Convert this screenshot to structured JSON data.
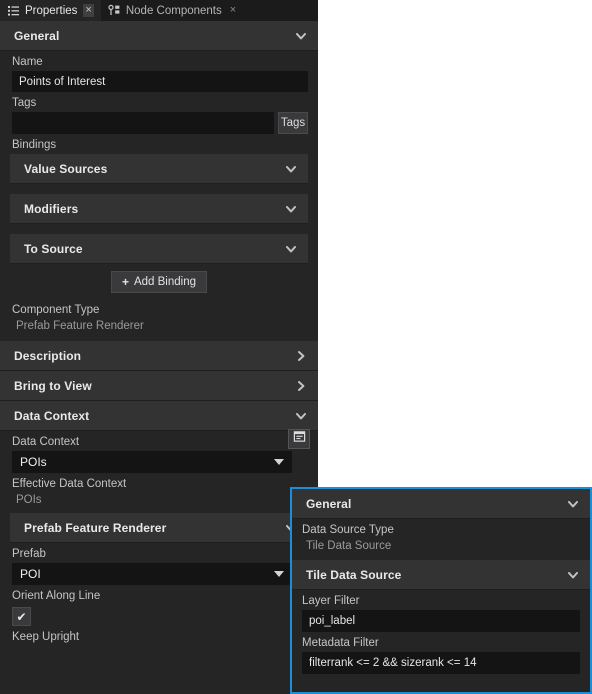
{
  "tabs": [
    {
      "label": "Properties",
      "icon": "list-icon",
      "close": "×",
      "active": true
    },
    {
      "label": "Node Components",
      "icon": "node-components-icon",
      "close": "×",
      "active": false
    }
  ],
  "properties": {
    "general_section": "General",
    "name_label": "Name",
    "name_value": "Points of Interest",
    "tags_label": "Tags",
    "tags_value": "",
    "tags_button": "Tags",
    "bindings_label": "Bindings",
    "binding_sections": [
      {
        "title": "Value Sources",
        "state": "collapsed-down"
      },
      {
        "title": "Modifiers",
        "state": "collapsed-down"
      },
      {
        "title": "To Source",
        "state": "collapsed-down"
      }
    ],
    "add_binding_label": "Add Binding",
    "add_binding_plus": "+",
    "component_type_label": "Component Type",
    "component_type_value": "Prefab Feature Renderer",
    "description_section": "Description",
    "bring_to_view_section": "Bring to View",
    "data_context_section": "Data Context",
    "data_context_label": "Data Context",
    "data_context_value": "POIs",
    "data_context_button_icon": "panel-icon",
    "effective_data_context_label": "Effective Data Context",
    "effective_data_context_value": "POIs",
    "prefab_feature_renderer_section": "Prefab Feature Renderer",
    "prefab_label": "Prefab",
    "prefab_value": "POI",
    "orient_along_line_label": "Orient Along Line",
    "orient_along_line_checked": "✔",
    "keep_upright_label": "Keep Upright"
  },
  "popup": {
    "general_section": "General",
    "data_source_type_label": "Data Source Type",
    "data_source_type_value": "Tile Data Source",
    "tile_data_source_section": "Tile Data Source",
    "layer_filter_label": "Layer Filter",
    "layer_filter_value": "poi_label",
    "metadata_filter_label": "Metadata Filter",
    "metadata_filter_value": "filterrank <= 2 && sizerank <= 14"
  },
  "colors": {
    "panel_bg": "#252526",
    "section_bg": "#333334",
    "tabstrip_bg": "#1b1b1c",
    "input_bg": "#141414",
    "popup_border": "#1b8fd6",
    "text": "#e8e8e8",
    "muted_text": "#9a9a9a"
  }
}
